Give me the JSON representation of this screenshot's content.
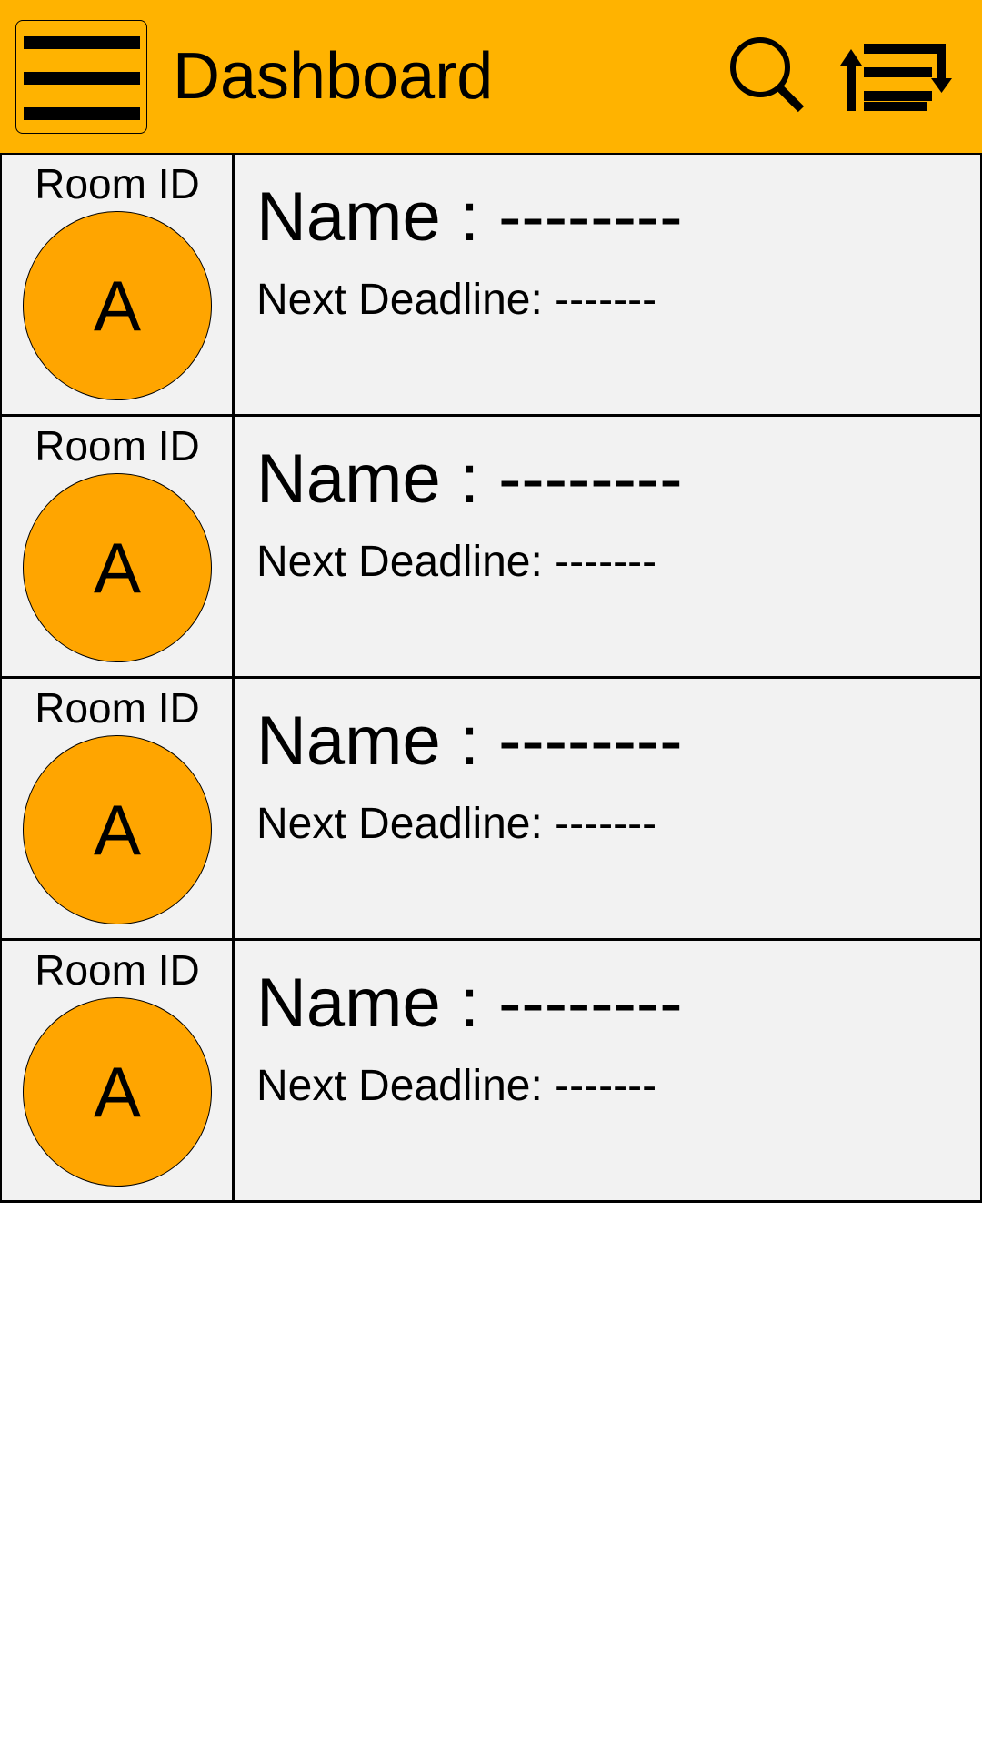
{
  "header": {
    "title": "Dashboard",
    "background_color": "#ffb300",
    "menu_icon": "hamburger-menu-icon",
    "search_icon": "search-icon",
    "sort_icon": "sort-icon"
  },
  "rooms": [
    {
      "room_label": "Room ID",
      "avatar_letter": "A",
      "name_text": "Name : --------",
      "deadline_text": "Next Deadline: -------"
    },
    {
      "room_label": "Room ID",
      "avatar_letter": "A",
      "name_text": "Name : --------",
      "deadline_text": "Next Deadline: -------"
    },
    {
      "room_label": "Room ID",
      "avatar_letter": "A",
      "name_text": "Name : --------",
      "deadline_text": "Next Deadline: -------"
    },
    {
      "room_label": "Room ID",
      "avatar_letter": "A",
      "name_text": "Name : --------",
      "deadline_text": "Next Deadline: -------"
    }
  ],
  "colors": {
    "avatar": "#ffa500",
    "row_background": "#f2f2f2"
  }
}
